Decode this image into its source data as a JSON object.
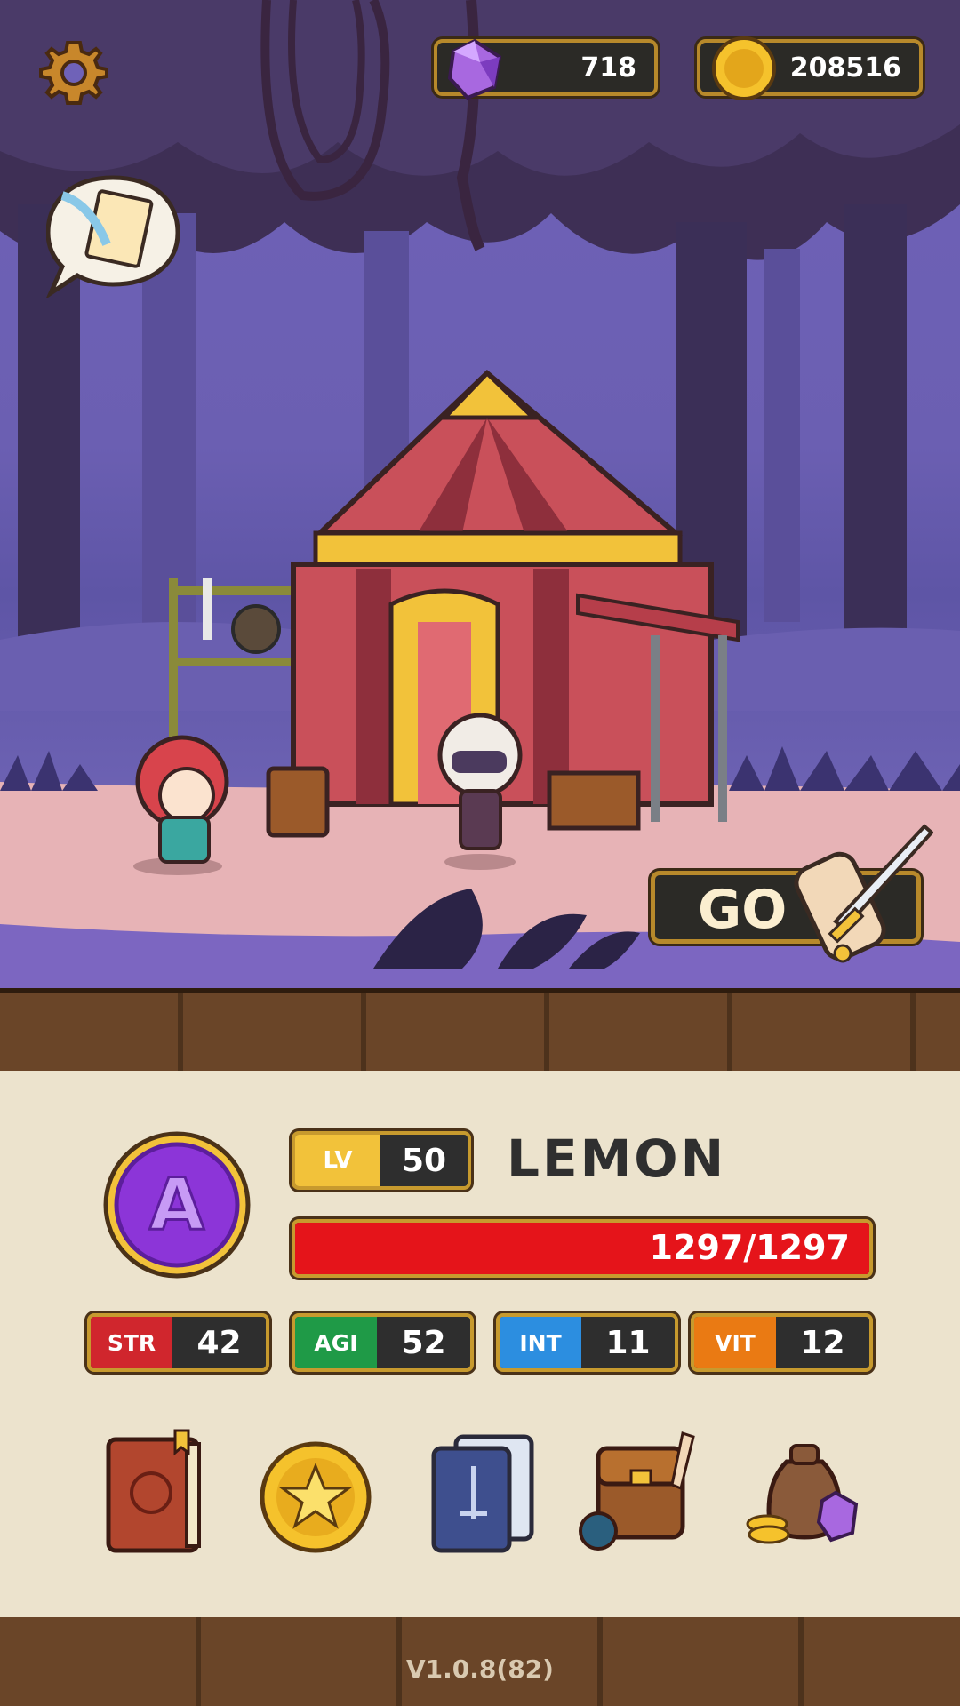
{
  "hud": {
    "gems": "718",
    "gold": "208516",
    "settings_icon": "gear-icon",
    "gem_icon": "purple-gem-icon",
    "coin_icon": "gold-coin-icon",
    "quest_icon": "quest-scroll-icon"
  },
  "scene": {
    "go_label": "GO",
    "go_icon": "scroll-sword-icon"
  },
  "hero": {
    "level_tag": "LV",
    "level": "50",
    "name": "LEMON",
    "hp_text": "1297/1297",
    "hp_fraction": 1.0,
    "rank_icon": "purple-rank-a-badge-icon",
    "stats": [
      {
        "tag": "STR",
        "value": "42",
        "color": "#d0262d"
      },
      {
        "tag": "AGI",
        "value": "52",
        "color": "#1f9a47"
      },
      {
        "tag": "INT",
        "value": "11",
        "color": "#2c8ee0"
      },
      {
        "tag": "VIT",
        "value": "12",
        "color": "#ea7a13"
      }
    ]
  },
  "menu": [
    {
      "icon": "hero-book-icon"
    },
    {
      "icon": "star-coin-icon"
    },
    {
      "icon": "card-deck-icon"
    },
    {
      "icon": "backpack-icon"
    },
    {
      "icon": "loot-bag-icon"
    }
  ],
  "footer": {
    "version": "V1.0.8(82)"
  },
  "colors": {
    "hp_red": "#e5141a",
    "gold_border": "#c79a2e",
    "panel_bg": "#ece3cd",
    "wood": "#5b3b22"
  }
}
